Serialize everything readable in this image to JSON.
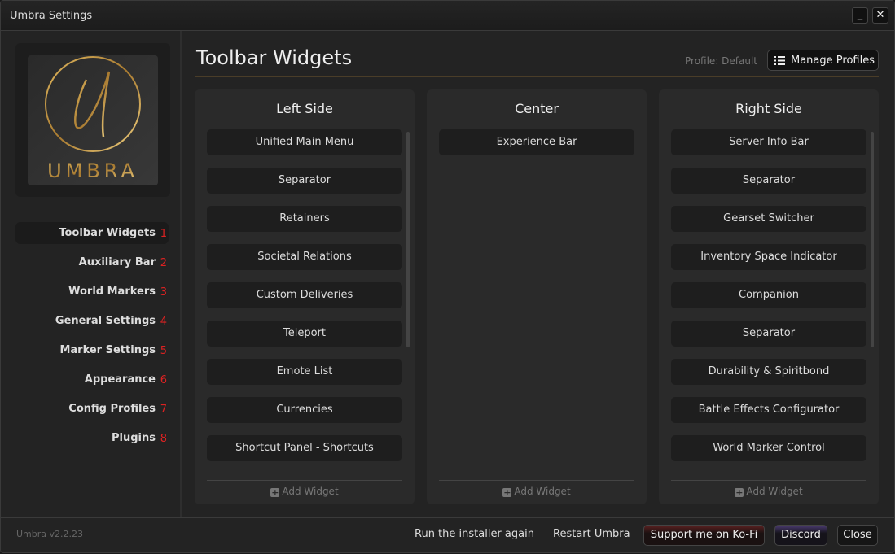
{
  "window": {
    "title": "Umbra Settings",
    "minimize": "_",
    "close": "✕"
  },
  "logo": {
    "text": "UMBRA",
    "letter": "U"
  },
  "nav": [
    {
      "label": "Toolbar Widgets",
      "num": "1"
    },
    {
      "label": "Auxiliary Bar",
      "num": "2"
    },
    {
      "label": "World Markers",
      "num": "3"
    },
    {
      "label": "General Settings",
      "num": "4"
    },
    {
      "label": "Marker Settings",
      "num": "5"
    },
    {
      "label": "Appearance",
      "num": "6"
    },
    {
      "label": "Config Profiles",
      "num": "7"
    },
    {
      "label": "Plugins",
      "num": "8"
    }
  ],
  "header": {
    "title": "Toolbar Widgets",
    "profile": "Profile: Default",
    "manage": "Manage Profiles"
  },
  "columns": [
    {
      "title": "Left Side",
      "items": [
        "Unified Main Menu",
        "Separator",
        "Retainers",
        "Societal Relations",
        "Custom Deliveries",
        "Teleport",
        "Emote List",
        "Currencies",
        "Shortcut Panel - Shortcuts"
      ],
      "add": "Add Widget"
    },
    {
      "title": "Center",
      "items": [
        "Experience Bar"
      ],
      "add": "Add Widget"
    },
    {
      "title": "Right Side",
      "items": [
        "Server Info Bar",
        "Separator",
        "Gearset Switcher",
        "Inventory Space Indicator",
        "Companion",
        "Separator",
        "Durability & Spiritbond",
        "Battle Effects Configurator",
        "World Marker Control"
      ],
      "add": "Add Widget"
    }
  ],
  "footer": {
    "version": "Umbra v2.2.23",
    "installer": "Run the installer again",
    "restart": "Restart Umbra",
    "kofi": "Support me on Ko-Fi",
    "discord": "Discord",
    "close": "Close"
  },
  "colors": {
    "accent_gold": "#c9a24a",
    "number_red": "#dd2222",
    "kofi": "#5a2020",
    "discord": "#4a3a70"
  }
}
